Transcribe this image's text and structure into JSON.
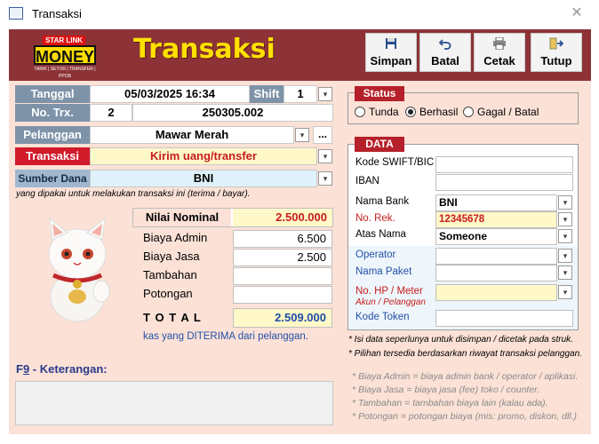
{
  "window": {
    "title": "Transaksi",
    "close_glyph": "✕"
  },
  "header": {
    "app_title": "Transaksi",
    "logo": {
      "line1": "STAR LINK",
      "line2": "MONEY",
      "line3": "TARIK | SETOR | TRANSFER | PPOB"
    },
    "buttons": {
      "save": "Simpan",
      "cancel": "Batal",
      "print": "Cetak",
      "close": "Tutup"
    }
  },
  "form": {
    "tanggal_label": "Tanggal",
    "tanggal_value": "05/03/2025 16:34",
    "shift_label": "Shift",
    "shift_value": "1",
    "notrx_label": "No. Trx.",
    "notrx_short": "2",
    "notrx_value": "250305.002",
    "pelanggan_label": "Pelanggan",
    "pelanggan_value": "Mawar Merah",
    "pelanggan_more": "...",
    "transaksi_label": "Transaksi",
    "transaksi_value": "Kirim uang/transfer",
    "sumber_label": "Sumber Dana",
    "sumber_value": "BNI",
    "sumber_note": "yang dipakai untuk melakukan transaksi ini (terima / bayar)."
  },
  "amounts": {
    "nominal_label": "Nilai Nominal",
    "nominal_value": "2.500.000",
    "admin_label": "Biaya Admin",
    "admin_value": "6.500",
    "jasa_label": "Biaya Jasa",
    "jasa_value": "2.500",
    "tambahan_label": "Tambahan",
    "tambahan_value": "",
    "potongan_label": "Potongan",
    "potongan_value": "",
    "total_label": "T O T A L",
    "total_value": "2.509.000",
    "total_note": "kas yang DITERIMA dari pelanggan."
  },
  "keterangan": {
    "label_prefix": "F",
    "label_underline": "9",
    "label_suffix": " - Keterangan:",
    "value": ""
  },
  "status": {
    "title": "Status",
    "options": [
      "Tunda",
      "Berhasil",
      "Gagal / Batal"
    ],
    "selected": "Berhasil"
  },
  "data": {
    "title": "DATA",
    "swift_label": "Kode SWIFT/BIC",
    "swift_value": "",
    "iban_label": "IBAN",
    "iban_value": "",
    "bank_label": "Nama Bank",
    "bank_value": "BNI",
    "norek_label": "No. Rek.",
    "norek_value": "12345678",
    "atasnama_label": "Atas Nama",
    "atasnama_value": "Someone",
    "operator_label": "Operator",
    "operator_value": "",
    "paket_label": "Nama Paket",
    "paket_value": "",
    "hp_label": "No. HP / Meter",
    "hp_sublabel": "Akun / Pelanggan",
    "hp_value": "",
    "token_label": "Kode Token",
    "token_value": ""
  },
  "notes": {
    "n1": "* Isi data seperlunya untuk disimpan / dicetak pada struk.",
    "n2": "* Pilihan tersedia berdasarkan riwayat transaksi pelanggan.",
    "g1": "* Biaya Admin = biaya admin bank / operator / aplikasi.",
    "g2": "* Biaya Jasa = biaya jasa (fee) toko / counter.",
    "g3": "* Tambahan = tambahan biaya lain (kalau ada).",
    "g4": "* Potongan = potongan biaya (mis: promo, diskon, dll.)"
  },
  "colors": {
    "header_bg": "#8d3337",
    "body_bg": "#fbe1d6",
    "title_yellow": "#ffe000",
    "accent_red": "#d11a2a",
    "label_bg": "#7e93a8"
  }
}
